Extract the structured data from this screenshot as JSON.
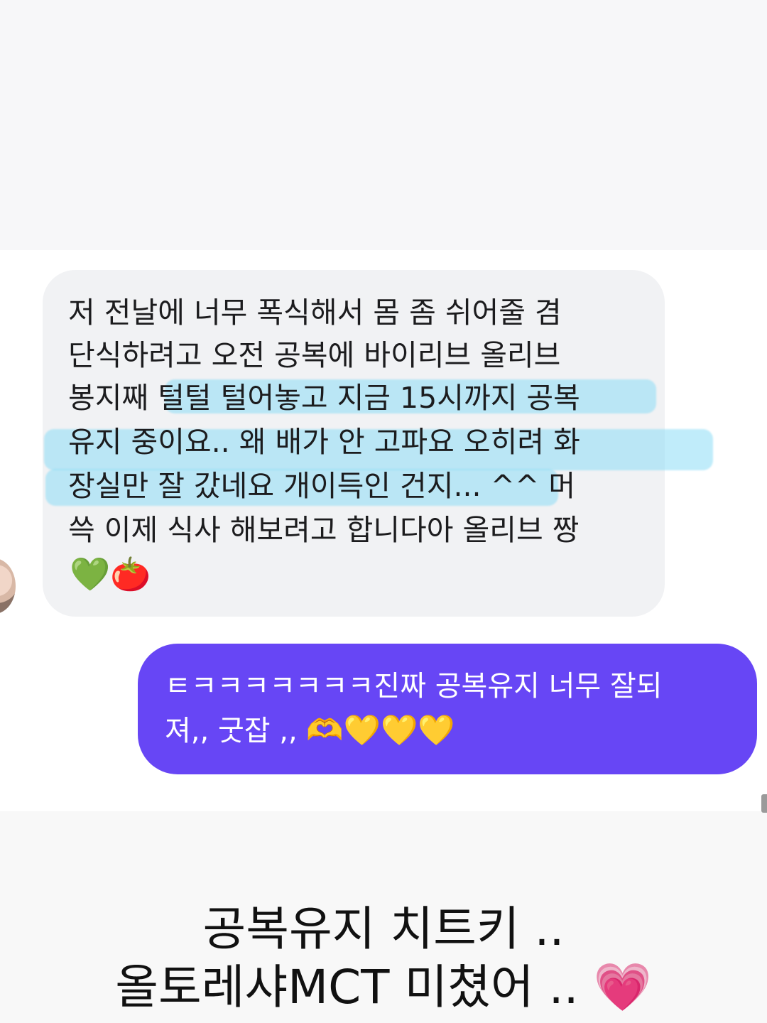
{
  "chat": {
    "received": {
      "lines": [
        "저 전날에 너무 폭식해서 몸 좀 쉬어줄 겸",
        "단식하려고 오전 공복에 바이리브 올리브",
        "봉지째 털털 털어놓고 지금 15시까지 공복",
        "유지 중이요.. 왜 배가 안 고파요 오히려 화",
        "장실만 잘 갔네요 개이득인 건지... ^^ 머",
        "쓱 이제 식사 해보려고 합니다아 올리브 짱"
      ],
      "emojis": "💚🍅"
    },
    "sent": {
      "line1": "ㅌㅋㅋㅋㅋㅋㅋㅋ진짜 공복유지 너무 잘되",
      "line2_text": "져,, 굿잡 ,, ",
      "line2_emojis": "🫶💛💛💛"
    }
  },
  "caption": {
    "line1": "공복유지 치트키 ..",
    "line2": "올토레샤MCT 미쳤어 .. 💗"
  },
  "colors": {
    "sent_bubble": "#6746f5",
    "received_bubble": "#f1f2f4",
    "highlight": "#8cdcf5"
  }
}
